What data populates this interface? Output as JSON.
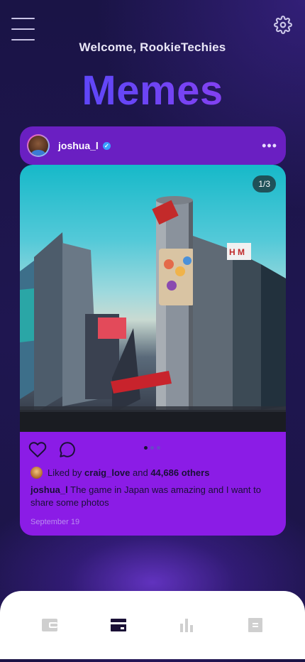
{
  "header": {
    "welcome_text": "Welcome, RookieTechies",
    "title": "Memes",
    "menu_icon": "hamburger-menu-icon",
    "settings_icon": "gear-icon"
  },
  "post": {
    "username": "joshua_l",
    "verified_icon": "verified-badge-icon",
    "more_icon": "more-dots-icon",
    "more_label": "•••",
    "image_counter": "1/3",
    "image_index": 1,
    "image_total": 3,
    "like_icon": "heart-icon",
    "comment_icon": "comment-bubble-icon",
    "liked_prefix": "Liked by",
    "liked_by_user": "craig_love",
    "liked_and": "and",
    "liked_others": "44,686 others",
    "caption_user": "joshua_l",
    "caption_text": "The game in Japan was amazing and I want to share some photos",
    "date": "September 19"
  },
  "bottom_nav": {
    "items": [
      {
        "icon": "wallet-icon",
        "active": false
      },
      {
        "icon": "card-icon",
        "active": true
      },
      {
        "icon": "bar-chart-icon",
        "active": false
      },
      {
        "icon": "document-icon",
        "active": false
      }
    ]
  },
  "colors": {
    "background": "#1d1547",
    "post_header": "#6a1fc2",
    "post_footer": "#8b1ce6",
    "title_gradient_start": "#4f49ff",
    "title_gradient_end": "#9a3df0",
    "nav_active": "#1a1036",
    "nav_inactive": "#c8c8c8"
  }
}
